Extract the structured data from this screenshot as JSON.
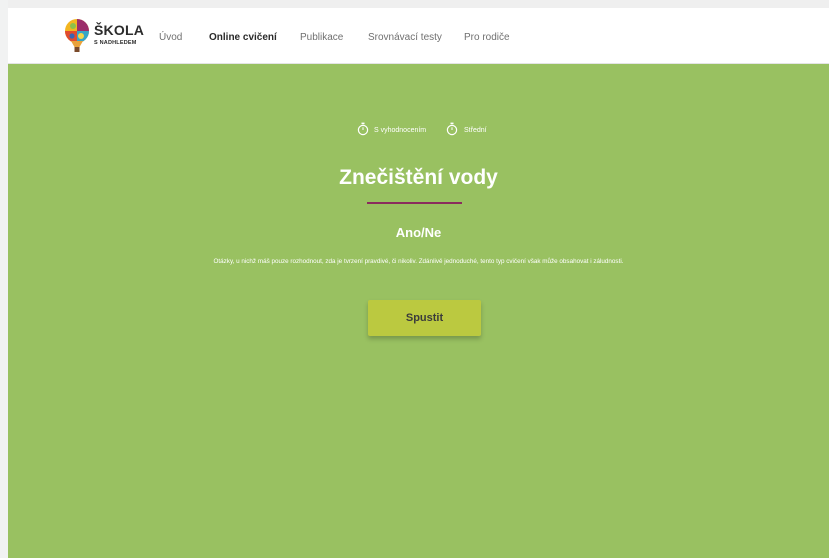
{
  "header": {
    "logo": {
      "title": "ŠKOLA",
      "subtitle": "S NADHLEDEM",
      "icon": "hot-air-balloon-icon"
    },
    "nav": [
      {
        "label": "Úvod",
        "active": false
      },
      {
        "label": "Online cvičení",
        "active": true
      },
      {
        "label": "Publikace",
        "active": false
      },
      {
        "label": "Srovnávací testy",
        "active": false
      },
      {
        "label": "Pro rodiče",
        "active": false
      }
    ]
  },
  "hero": {
    "meta": [
      {
        "icon": "stopwatch-icon",
        "label": "S vyhodnocením"
      },
      {
        "icon": "stopwatch-icon",
        "label": "Střední"
      }
    ],
    "title": "Znečištění vody",
    "subtitle": "Ano/Ne",
    "description": "Otázky, u nichž máš pouze rozhodnout, zda je tvrzení pravdivé, či nikoliv. Zdánlivě jednoduché, tento typ cvičení však může obsahovat i záludnosti.",
    "start_label": "Spustit"
  },
  "colors": {
    "hero_background": "#99c161",
    "button_background": "#bbc940",
    "title_underline": "#8a2c5d"
  }
}
